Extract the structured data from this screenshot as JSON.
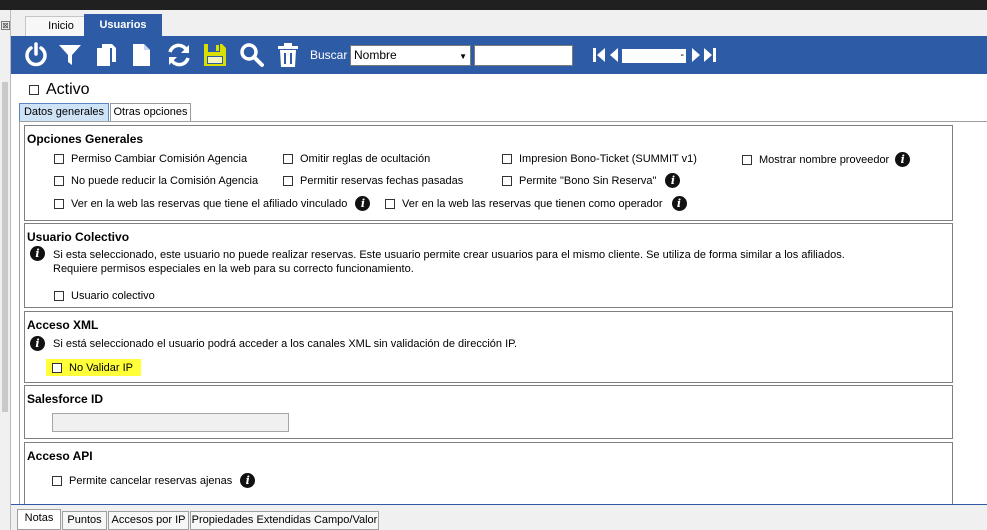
{
  "colors": {
    "toolbar_bg": "#2d5ba6",
    "highlight": "#ffff3a",
    "selected_tab": "#cfe3f7"
  },
  "left_strip": {
    "close_glyph": "⊠"
  },
  "top_tabs": [
    {
      "label": "Inicio"
    },
    {
      "label": "Usuarios"
    }
  ],
  "toolbar": {
    "icons": [
      "power-icon",
      "filter-icon",
      "copy-icon",
      "new-document-icon",
      "refresh-icon",
      "save-icon",
      "search-icon",
      "trash-icon"
    ],
    "search_label": "Buscar",
    "search_field_selected": "Nombre",
    "search_value": "",
    "nav_value": "-"
  },
  "activo_label": "Activo",
  "subtabs": [
    {
      "label": "Datos generales"
    },
    {
      "label": "Otras opciones"
    }
  ],
  "opciones_generales": {
    "title": "Opciones Generales",
    "options": [
      "Permiso Cambiar Comisión Agencia",
      "Omitir reglas de ocultación",
      "Impresion Bono-Ticket (SUMMIT v1)",
      "Mostrar nombre proveedor",
      "No puede reducir la Comisión Agencia",
      "Permitir reservas fechas pasadas",
      "Permite \"Bono Sin Reserva\"",
      "Ver en la web las reservas que tiene el afiliado vinculado",
      "Ver en la web las reservas que tienen como operador"
    ]
  },
  "usuario_colectivo": {
    "title": "Usuario Colectivo",
    "description_line1": "Si esta seleccionado, este usuario no puede realizar reservas. Este usuario permite crear usuarios para el mismo cliente. Se utiliza de forma similar a los afiliados.",
    "description_line2": "Requiere permisos especiales en la web para su correcto funcionamiento.",
    "option": "Usuario colectivo"
  },
  "acceso_xml": {
    "title": "Acceso XML",
    "description": "Si está seleccionado el usuario podrá acceder a los canales XML sin validación de dirección IP.",
    "option": "No Validar IP"
  },
  "salesforce": {
    "title": "Salesforce ID",
    "value": ""
  },
  "acceso_api": {
    "title": "Acceso API",
    "option": "Permite cancelar reservas ajenas"
  },
  "bottom_tabs": [
    {
      "label": "Notas"
    },
    {
      "label": "Puntos"
    },
    {
      "label": "Accesos por IP"
    },
    {
      "label": "Propiedades Extendidas Campo/Valor"
    }
  ]
}
